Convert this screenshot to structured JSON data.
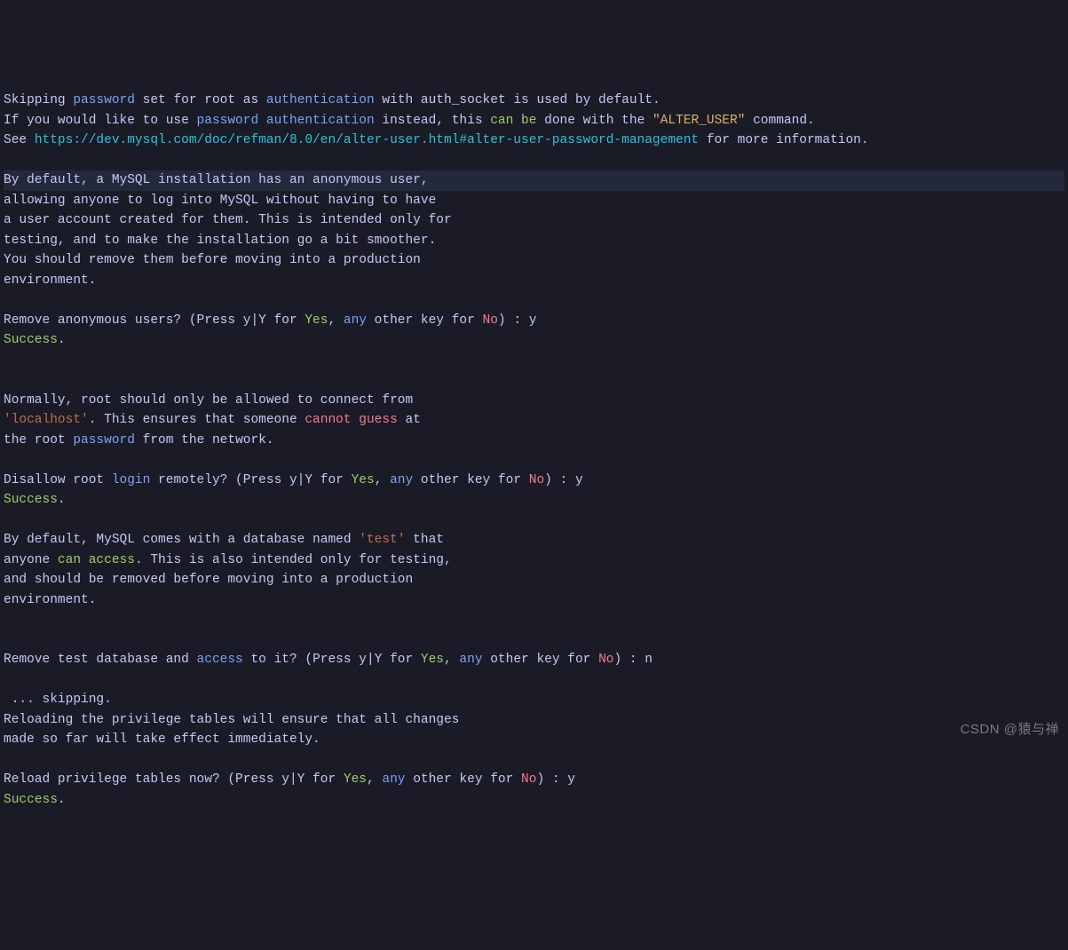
{
  "t": {
    "skipping": "Skipping ",
    "password": "password",
    "set_for_root": " set for root as ",
    "authentication": "authentication",
    "with_auth_socket": " with auth_socket is used by default.",
    "if_you_would": "If you would like to use ",
    "password2": "password",
    "space": " ",
    "authentication2": "authentication",
    "instead": " instead, this ",
    "can": "can",
    "be": "be",
    "done_with": " done with the ",
    "alter_user_str": "\"ALTER_USER\"",
    "command": " command.",
    "see": "See ",
    "url": "https://dev.mysql.com/doc/refman/8.0/en/alter-user.html#alter-user-password-management",
    "for_more": " for more information.",
    "blank": "",
    "by_default_anon": "By default, a MySQL installation has an anonymous user,",
    "allowing": "allowing anyone to log into MySQL without having to have",
    "a_user": "a user account created for them. This is intended only for",
    "testing": "testing, and to make the installation go a bit smoother.",
    "you_should": "You should remove them before moving into a production",
    "environment": "environment.",
    "remove_anon": "Remove anonymous users? (Press y|Y for ",
    "yes": "Yes",
    "comma_sp": ", ",
    "any": "any",
    "other_key_for": " other key for ",
    "no": "No",
    "paren_colon_y": ") : y",
    "success": "Success",
    "period": ".",
    "normally": "Normally, root should only be allowed to connect from",
    "localhost_q": "'localhost'",
    "this_ensures": ". This ensures that someone ",
    "cannot": "cannot",
    "guess": "guess",
    "at": " at",
    "the_root": "the root ",
    "password3": "password",
    "from_network": " from the network.",
    "disallow": "Disallow root ",
    "login": "login",
    "remotely": " remotely? (Press y|Y for ",
    "by_default_test": "By default, MySQL comes with a database named ",
    "test_q": "'test'",
    "that": " that",
    "anyone": "anyone ",
    "can2": "can",
    "access": "access",
    "this_also": ". This is also intended only for testing,",
    "and_should": "and should be removed before moving into a production",
    "remove_test": "Remove test database and ",
    "access2": "access",
    "to_it": " to it? (Press y|Y for ",
    "paren_colon_n": ") : n",
    "skipping2": " ... skipping.",
    "reloading": "Reloading the privilege tables will ensure that all changes",
    "made_so_far": "made so far will take effect immediately.",
    "reload": "Reload privilege tables now? (Press y|Y for "
  },
  "watermark": "CSDN @猿与禅"
}
